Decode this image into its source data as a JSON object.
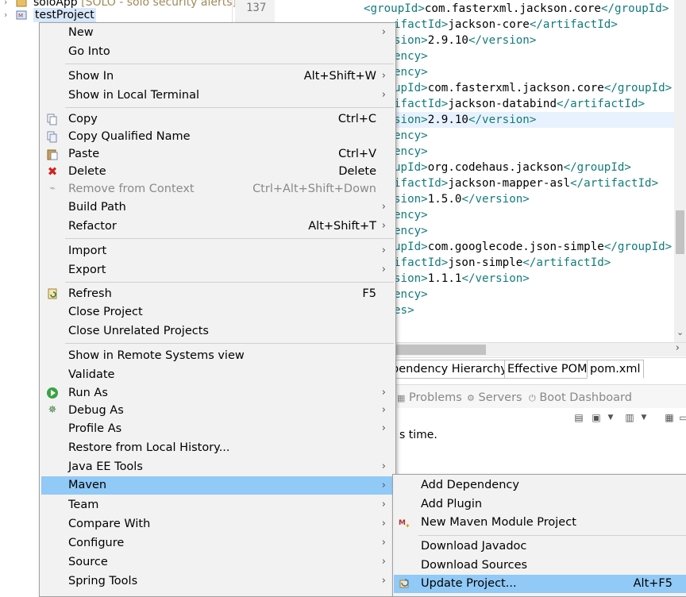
{
  "explorer": {
    "rows": [
      {
        "label": "soloApp",
        "suffix": "[SOLO - solo security alerts]"
      },
      {
        "label": "testProject"
      }
    ]
  },
  "editor": {
    "line_number": "137",
    "lines": [
      {
        "prefix": "<groupId>",
        "text": "com.fasterxml.jackson.core",
        "suffix": "</groupId>"
      },
      {
        "prefix": "ifactId>",
        "text": "jackson-core",
        "suffix": "</artifactId>"
      },
      {
        "prefix": "sion>",
        "text": "2.9.10",
        "suffix": "</version>"
      },
      {
        "prefix": "ency>",
        "text": "",
        "suffix": ""
      },
      {
        "prefix": "ency>",
        "text": "",
        "suffix": ""
      },
      {
        "prefix": "upId>",
        "text": "com.fasterxml.jackson.core",
        "suffix": "</groupId>"
      },
      {
        "prefix": "ifactId>",
        "text": "jackson-databind",
        "suffix": "</artifactId>"
      },
      {
        "prefix": "sion>",
        "text": "2.9.10",
        "suffix": "</version>"
      },
      {
        "prefix": "ency>",
        "text": "",
        "suffix": ""
      },
      {
        "prefix": "ency>",
        "text": "",
        "suffix": ""
      },
      {
        "prefix": "upId>",
        "text": "org.codehaus.jackson",
        "suffix": "</groupId>"
      },
      {
        "prefix": "ifactId>",
        "text": "jackson-mapper-asl",
        "suffix": "</artifactId>"
      },
      {
        "prefix": "sion>",
        "text": "1.5.0",
        "suffix": "</version>"
      },
      {
        "prefix": "ency>",
        "text": "",
        "suffix": ""
      },
      {
        "prefix": "ency>",
        "text": "",
        "suffix": ""
      },
      {
        "prefix": "upId>",
        "text": "com.googlecode.json-simple",
        "suffix": "</groupId>"
      },
      {
        "prefix": "ifactId>",
        "text": "json-simple",
        "suffix": "</artifactId>"
      },
      {
        "prefix": "sion>",
        "text": "1.1.1",
        "suffix": "</version>"
      },
      {
        "prefix": "ency>",
        "text": "",
        "suffix": ""
      },
      {
        "prefix": "es>",
        "text": "",
        "suffix": ""
      }
    ]
  },
  "pom_tabs": [
    "pendency Hierarchy",
    "Effective POM",
    "pom.xml"
  ],
  "views": [
    "Problems",
    "Servers",
    "Boot Dashboard"
  ],
  "console": {
    "text": "s time."
  },
  "context_menu": {
    "items": [
      {
        "label": "New",
        "accel": "",
        "submenu": true
      },
      {
        "label": "Go Into",
        "accel": ""
      },
      {
        "label": "Show In",
        "accel": "Alt+Shift+W",
        "submenu": true
      },
      {
        "label": "Show in Local Terminal",
        "accel": "",
        "submenu": true
      },
      {
        "label": "Copy",
        "accel": "Ctrl+C",
        "icon": "copy-icon"
      },
      {
        "label": "Copy Qualified Name",
        "accel": "",
        "icon": "copy-qualified-icon"
      },
      {
        "label": "Paste",
        "accel": "Ctrl+V",
        "icon": "paste-icon"
      },
      {
        "label": "Delete",
        "accel": "Delete",
        "icon": "delete-icon"
      },
      {
        "label": "Remove from Context",
        "accel": "Ctrl+Alt+Shift+Down",
        "icon": "remove-context-icon",
        "disabled": true
      },
      {
        "label": "Build Path",
        "accel": "",
        "submenu": true
      },
      {
        "label": "Refactor",
        "accel": "Alt+Shift+T",
        "submenu": true
      },
      {
        "label": "Import",
        "accel": "",
        "submenu": true
      },
      {
        "label": "Export",
        "accel": "",
        "submenu": true
      },
      {
        "label": "Refresh",
        "accel": "F5",
        "icon": "refresh-icon"
      },
      {
        "label": "Close Project",
        "accel": ""
      },
      {
        "label": "Close Unrelated Projects",
        "accel": ""
      },
      {
        "label": "Show in Remote Systems view",
        "accel": ""
      },
      {
        "label": "Validate",
        "accel": ""
      },
      {
        "label": "Run As",
        "accel": "",
        "submenu": true,
        "icon": "run-icon"
      },
      {
        "label": "Debug As",
        "accel": "",
        "submenu": true,
        "icon": "debug-icon"
      },
      {
        "label": "Profile As",
        "accel": "",
        "submenu": true
      },
      {
        "label": "Restore from Local History...",
        "accel": ""
      },
      {
        "label": "Java EE Tools",
        "accel": "",
        "submenu": true
      },
      {
        "label": "Maven",
        "accel": "",
        "submenu": true,
        "highlighted": true
      },
      {
        "label": "Team",
        "accel": "",
        "submenu": true
      },
      {
        "label": "Compare With",
        "accel": "",
        "submenu": true
      },
      {
        "label": "Configure",
        "accel": "",
        "submenu": true
      },
      {
        "label": "Source",
        "accel": "",
        "submenu": true
      },
      {
        "label": "Spring Tools",
        "accel": "",
        "submenu": true
      }
    ]
  },
  "maven_submenu": {
    "items": [
      {
        "label": "Add Dependency",
        "accel": ""
      },
      {
        "label": "Add Plugin",
        "accel": ""
      },
      {
        "label": "New Maven Module Project",
        "accel": "",
        "icon": "maven-module-icon"
      },
      {
        "label": "Download Javadoc",
        "accel": ""
      },
      {
        "label": "Download Sources",
        "accel": ""
      },
      {
        "label": "Update Project...",
        "accel": "Alt+F5",
        "icon": "update-project-icon",
        "highlighted": true
      }
    ]
  },
  "colors": {
    "menu_highlight": "#91c9f7",
    "xml_tag": "#127b7b"
  }
}
